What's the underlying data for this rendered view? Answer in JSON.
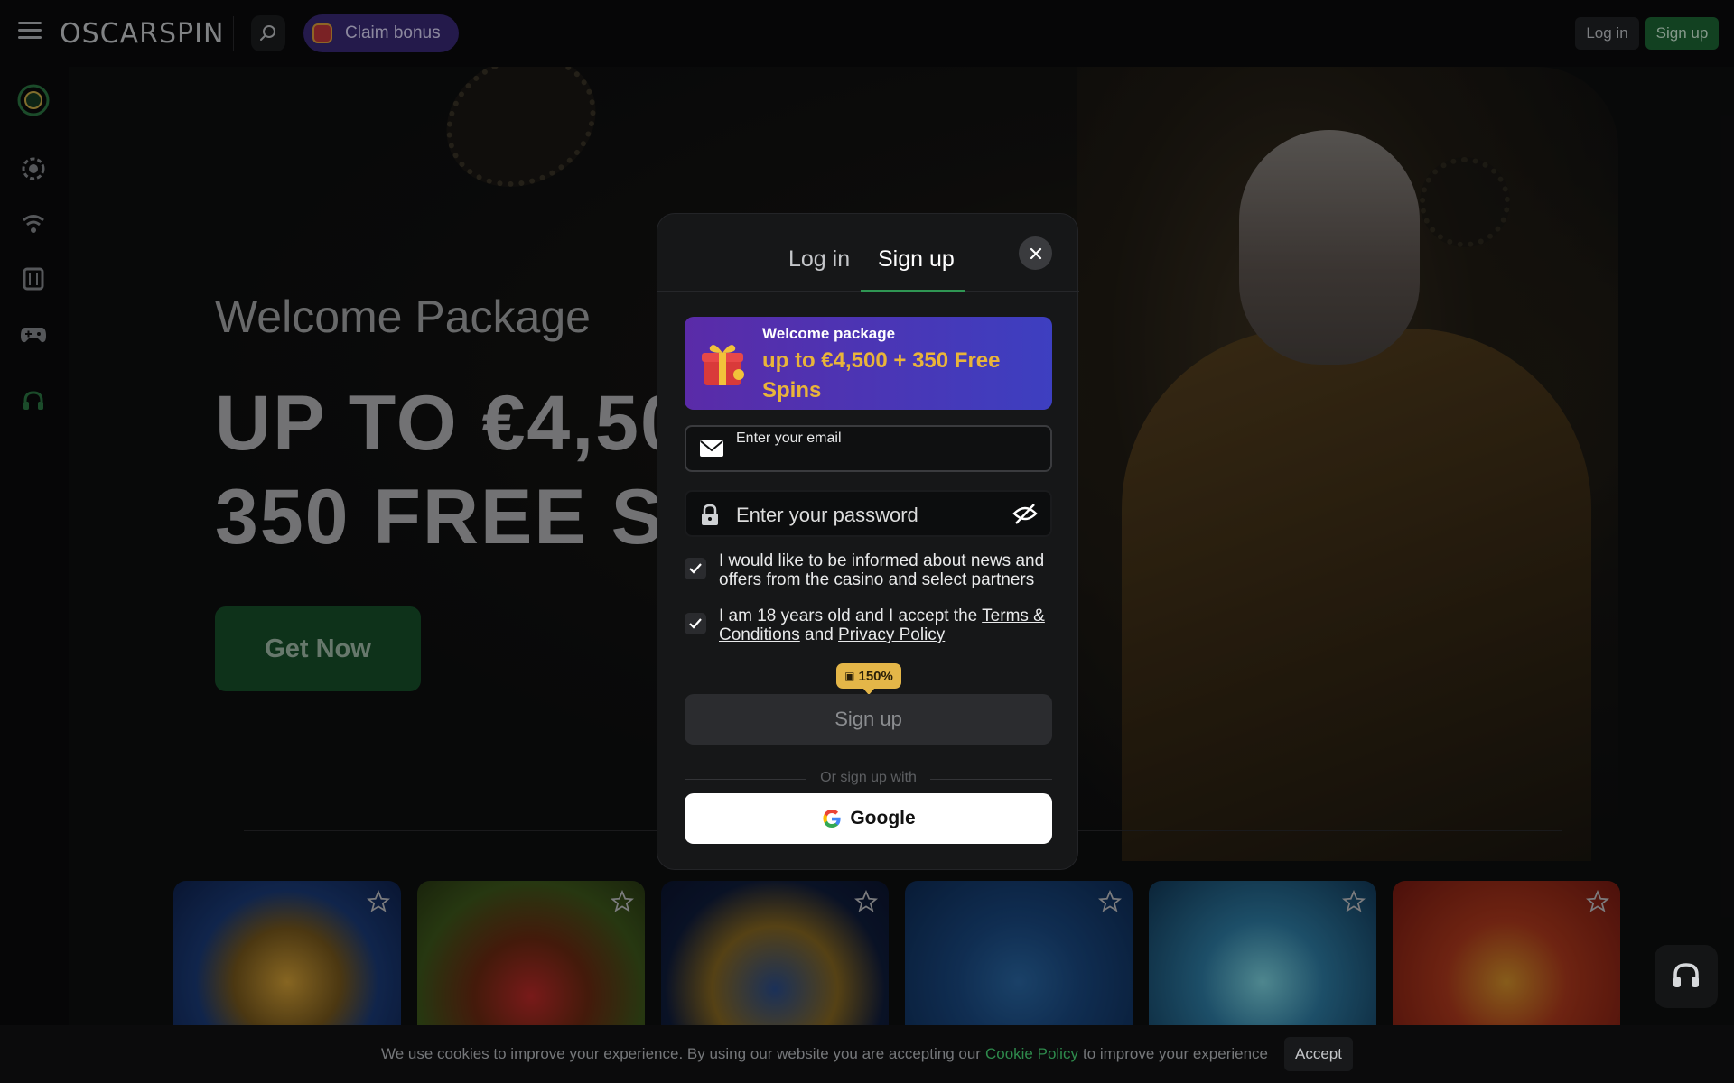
{
  "header": {
    "logo_text": "OSCARSPIN",
    "claim_bonus_label": "Claim bonus",
    "login_label": "Log in",
    "signup_label": "Sign up"
  },
  "hero": {
    "welcome_title": "Welcome Package",
    "headline_line1": "UP TO €4,50",
    "headline_line2": "350 FREE SP",
    "cta_label": "Get Now"
  },
  "modal": {
    "tab_login": "Log in",
    "tab_signup": "Sign up",
    "promo": {
      "title": "Welcome package",
      "subtitle": "up to €4,500 + 350 Free Spins"
    },
    "email": {
      "label": "Enter your email",
      "value": ""
    },
    "password": {
      "placeholder": "Enter your password",
      "value": ""
    },
    "checkbox_news": {
      "checked": true,
      "text": "I would like to be informed about news and offers from the casino and select partners"
    },
    "checkbox_age": {
      "checked": true,
      "text_before": "I am 18 years old and I accept the ",
      "terms_link": "Terms & Conditions",
      "text_mid": " and ",
      "privacy_link": "Privacy Policy"
    },
    "bonus_badge": "150%",
    "signup_button": "Sign up",
    "or_text": "Or sign up with",
    "google_button": "Google"
  },
  "cookie_bar": {
    "text_before": "We use cookies to improve your experience. By using our website you are accepting our",
    "link": "Cookie Policy",
    "text_after": "to improve your experience",
    "accept_label": "Accept"
  },
  "colors": {
    "accent_green": "#2f9653",
    "promo_purple": "#5a2ba8",
    "promo_gold": "#e9b43a",
    "badge_gold": "#e4b648"
  },
  "icons": {
    "rail": [
      "oscar-logo-icon",
      "casino-chip-icon",
      "live-signal-icon",
      "slots-icon",
      "gamepad-icon",
      "support-headset-icon"
    ]
  }
}
